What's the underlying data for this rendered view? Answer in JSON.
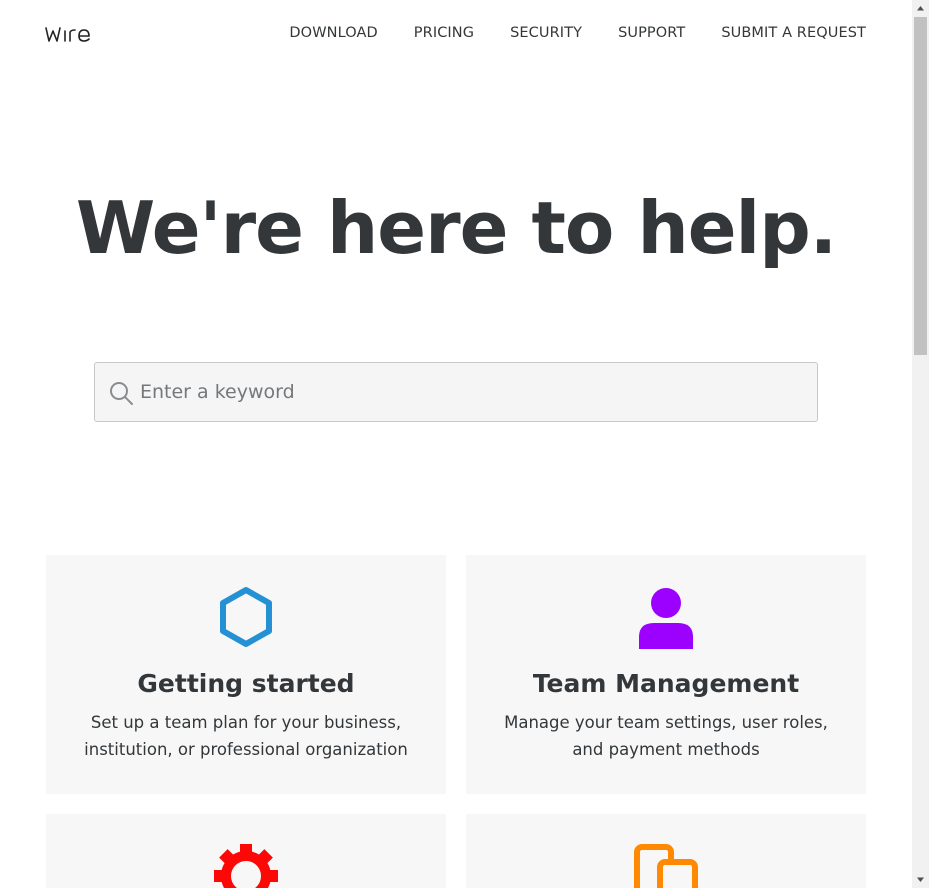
{
  "header": {
    "logo_text": "wire",
    "nav": [
      "DOWNLOAD",
      "PRICING",
      "SECURITY",
      "SUPPORT",
      "SUBMIT A REQUEST"
    ]
  },
  "hero": {
    "title": "We're here to help."
  },
  "search": {
    "placeholder": "Enter a keyword",
    "icon": "search-icon"
  },
  "cards": [
    {
      "title": "Getting started",
      "description": "Set up a team plan for your business, institution, or professional organization",
      "icon": "hexagon-icon",
      "icon_color": "#2391d3"
    },
    {
      "title": "Team Management",
      "description": "Manage your team settings, user roles, and payment methods",
      "icon": "user-icon",
      "icon_color": "#9c00fe"
    },
    {
      "title": "",
      "description": "",
      "icon": "gear-icon",
      "icon_color": "#fb0807"
    },
    {
      "title": "",
      "description": "",
      "icon": "devices-icon",
      "icon_color": "#ff8900"
    }
  ],
  "colors": {
    "text": "#33373a",
    "card_bg": "#f7f7f7",
    "search_bg": "#f5f5f5"
  }
}
